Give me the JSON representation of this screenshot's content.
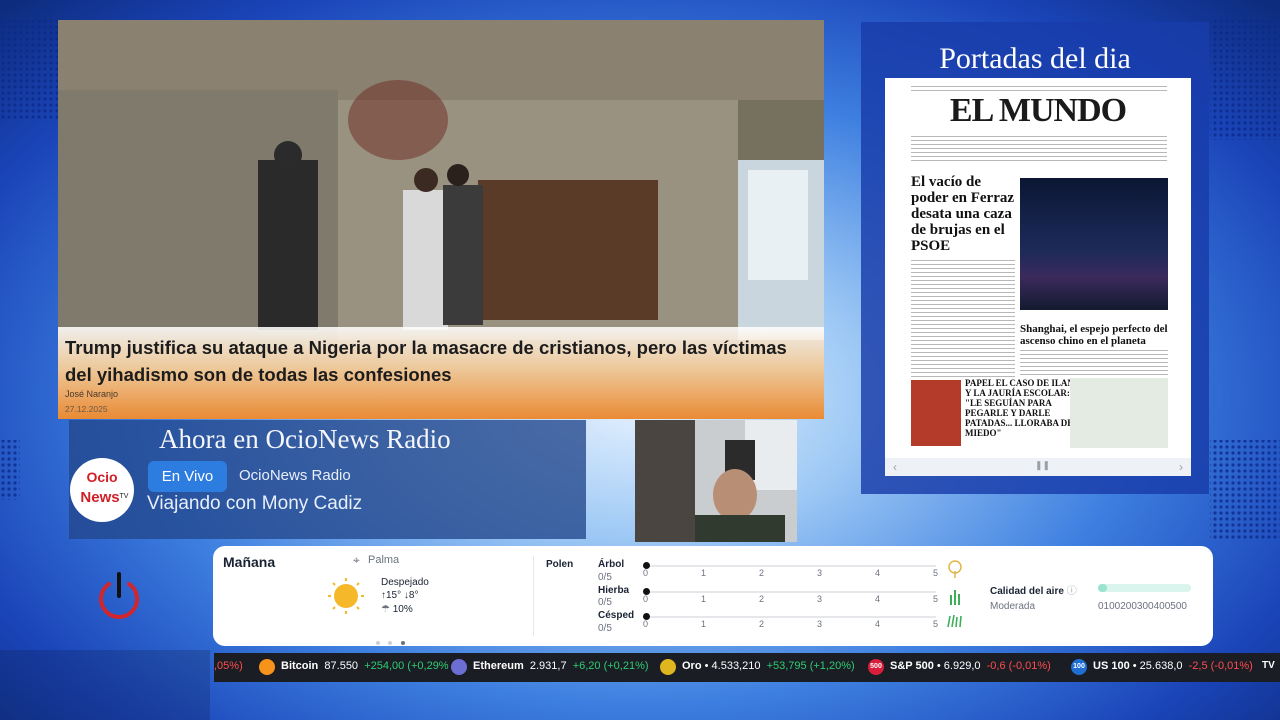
{
  "news": {
    "headline": "Trump justifica su ataque a Nigeria por la masacre de cristianos, pero las víctimas del yihadismo son de todas las confesiones",
    "author": "José Naranjo",
    "date": "27.12.2025"
  },
  "portadas": {
    "title": "Portadas del dia",
    "masthead": "EL MUNDO",
    "headline_main": "El vacío de poder en Ferraz desata una caza de brujas en el PSOE",
    "headline_shanghai": "Shanghai, el espejo perfecto del ascenso chino en el planeta",
    "headline_papel": "PAPEL EL CASO DE ILAN Y LA JAURÍA ESCOLAR: \"LE SEGUÍAN PARA PEGARLE Y DARLE PATADAS... LLORABA DE MIEDO\""
  },
  "radio": {
    "title": "Ahora en OcioNews Radio",
    "badge": "En Vivo",
    "station": "OcioNews Radio",
    "show": "Viajando con Mony Cadiz"
  },
  "weather": {
    "day": "Mañana",
    "location": "Palma",
    "condition": "Despejado",
    "max_temp": "15°",
    "min_temp": "8°",
    "rain": "10%",
    "pollen_label": "Polen",
    "pollen": [
      {
        "name": "Árbol",
        "value": "0/5"
      },
      {
        "name": "Hierba",
        "value": "0/5"
      },
      {
        "name": "Césped",
        "value": "0/5"
      }
    ],
    "scale": [
      "0",
      "1",
      "2",
      "3",
      "4",
      "5"
    ],
    "air_label": "Calidad del aire",
    "air_status": "Moderada",
    "air_scale": "0100200300400500",
    "air_level_fraction": 0.1
  },
  "ticker": [
    {
      "prefix": ",05%)",
      "name": "",
      "price": "",
      "change": "",
      "dir": "neg"
    },
    {
      "name": "Bitcoin",
      "price": "87.550",
      "change": "+254,00 (+0,29%",
      "dir": "pos",
      "color": "#f7931a"
    },
    {
      "name": "Ethereum",
      "price": "2.931,7",
      "change": "+6,20 (+0,21%)",
      "dir": "pos",
      "color": "#6c6fd1"
    },
    {
      "name": "Oro",
      "price": "• 4.533,210",
      "change": "+53,795 (+1,20%)",
      "dir": "pos",
      "color": "#e0b620"
    },
    {
      "name": "S&P 500",
      "price": "• 6.929,0",
      "change": "-0,6 (-0,01%)",
      "dir": "neg",
      "color": "#d91e3c"
    },
    {
      "name": "US 100",
      "price": "• 25.638,0",
      "change": "-2,5 (-0,01%)",
      "dir": "neg",
      "color": "#1f6fd1"
    }
  ],
  "ticker_badges": {
    "sp": "500",
    "us": "100",
    "tv": "TV"
  }
}
